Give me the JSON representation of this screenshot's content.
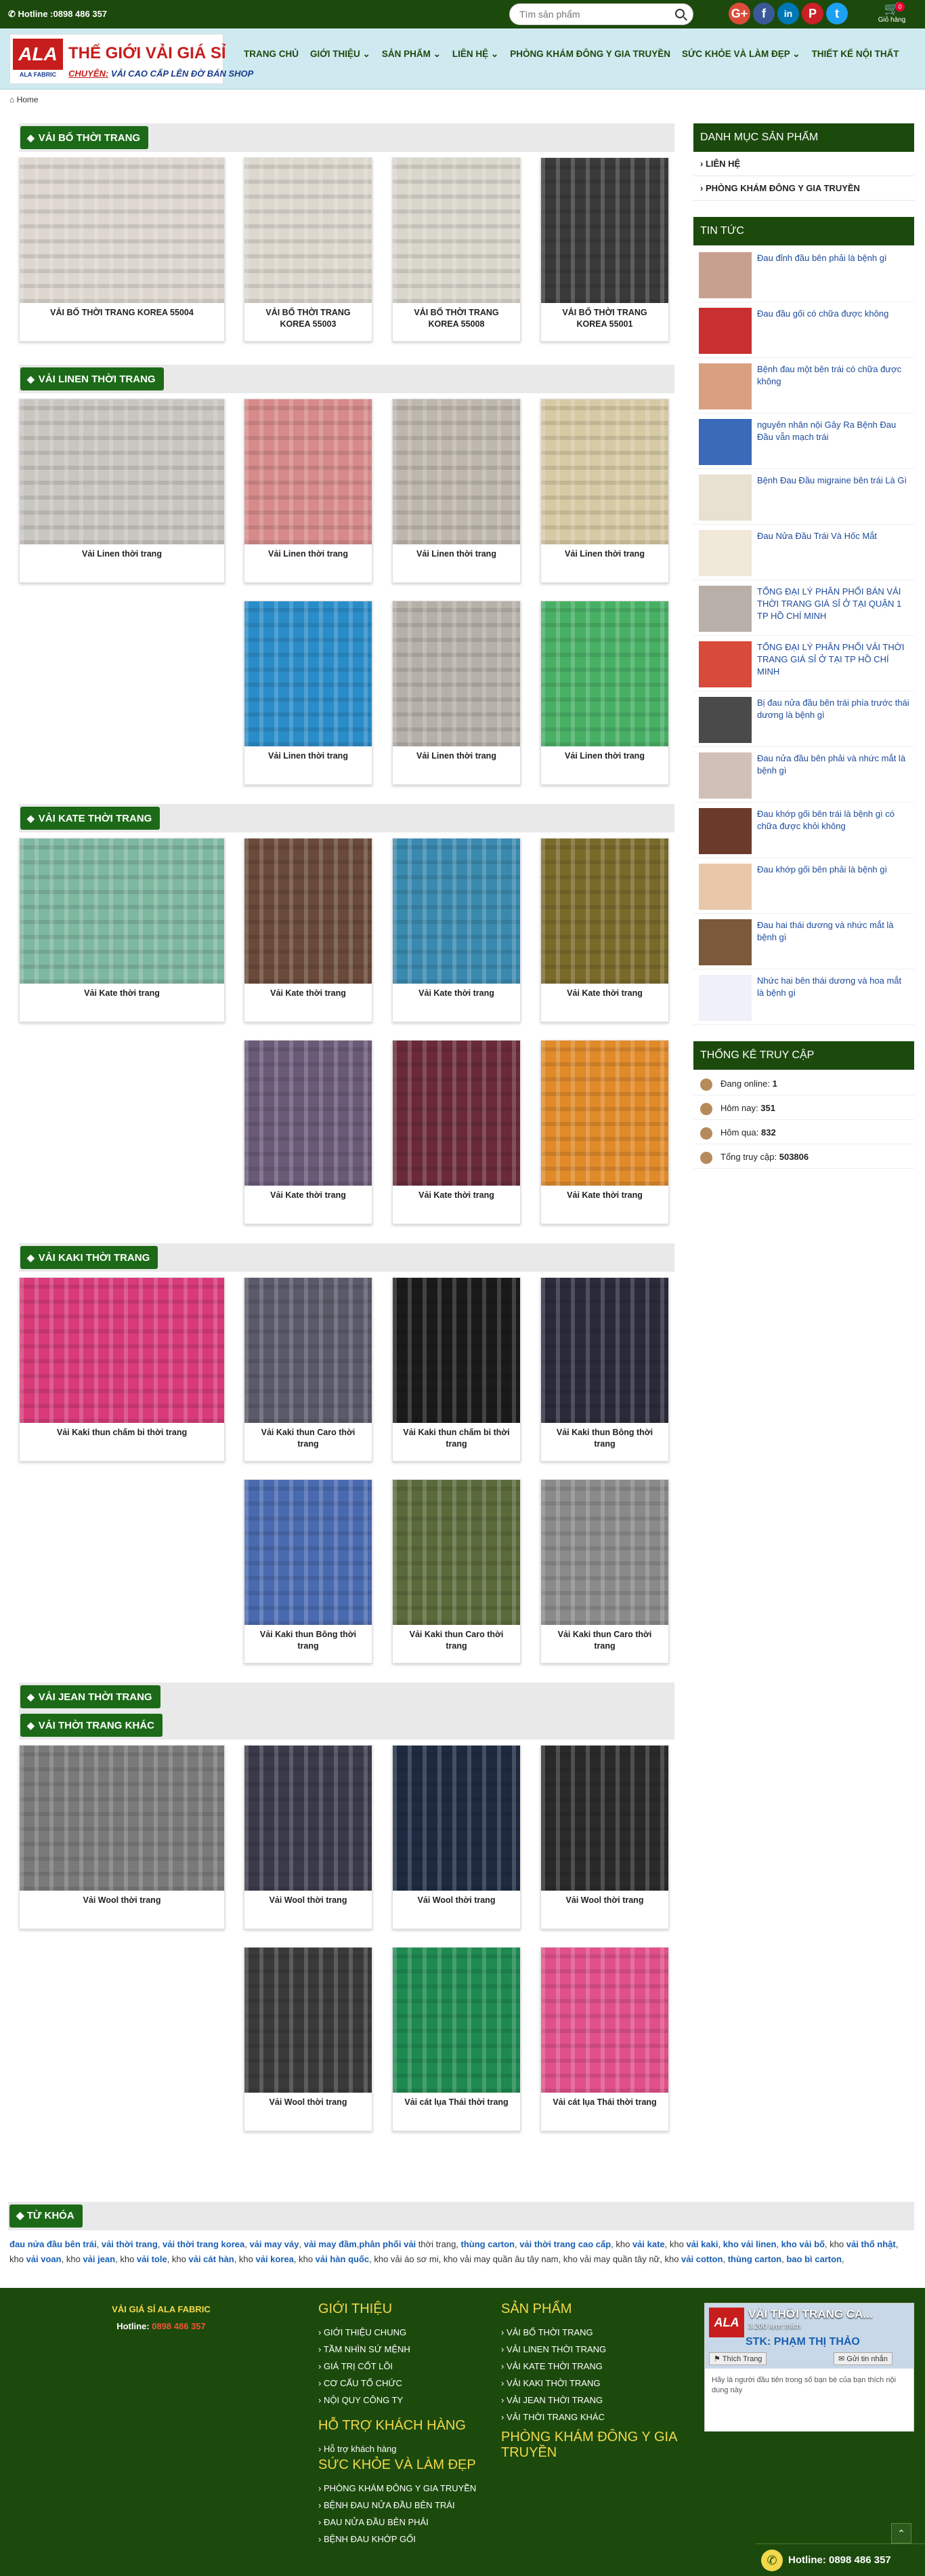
{
  "topbar": {
    "hotline": "Hotline :0898 486 357",
    "search_placeholder": "Tìm sản phẩm",
    "cart_label": "Giỏ hàng",
    "cart_count": "0",
    "social": [
      "G+",
      "f",
      "in",
      "P",
      "t"
    ]
  },
  "logo": {
    "mark": "ALA",
    "brand": "ALA FABRIC",
    "title": "THẾ GIỚI VẢI GIÁ SỈ",
    "tagline_prefix": "CHUYÊN:",
    "tagline": "VẢI CAO CẤP LÊN ĐỜ BÁN SHOP"
  },
  "nav": [
    "TRANG CHỦ",
    "GIỚI THIỆU ⌄",
    "SẢN PHẨM ⌄",
    "LIÊN HỆ ⌄",
    "PHÒNG KHÁM ĐÔNG Y GIA TRUYỀN",
    "SỨC KHỎE VÀ LÀM ĐẸP ⌄",
    "THIẾT KẾ NỘI THẤT"
  ],
  "breadcrumb": "Home",
  "sections": [
    {
      "title": "VẢI BỐ THỜI TRANG",
      "items": [
        {
          "name": "VẢI BỐ THỜI TRANG KOREA 55004",
          "color": "#ddd7cf"
        },
        {
          "name": "VẢI BỐ THỜI TRANG KOREA 55003",
          "color": "#dcd8ce"
        },
        {
          "name": "VẢI BỐ THỜI TRANG KOREA 55008",
          "color": "#d9d6cc"
        },
        {
          "name": "VẢI BỐ THỜI TRANG KOREA 55001",
          "color": "#3a3a3a"
        }
      ]
    },
    {
      "title": "VẢI LINEN THỜI TRANG",
      "items": [
        {
          "name": "Vải Linen thời trang",
          "color": "#c8c6c0"
        },
        {
          "name": "Vải Linen thời trang",
          "color": "#d78a8a"
        },
        {
          "name": "Vải Linen thời trang",
          "color": "#bdb7ad"
        },
        {
          "name": "Vải Linen thời trang",
          "color": "#d6c9a4"
        },
        {
          "name": "Vải Linen thời trang",
          "color": "#2a8cc8"
        },
        {
          "name": "Vải Linen thời trang",
          "color": "#b5b1a8"
        },
        {
          "name": "Vải Linen thời trang",
          "color": "#48b065"
        }
      ]
    },
    {
      "title": "VẢI KATE THỜI TRANG",
      "items": [
        {
          "name": "Vải Kate thời trang",
          "color": "#7fb8a0"
        },
        {
          "name": "Vải Kate thời trang",
          "color": "#6a4a3a"
        },
        {
          "name": "Vải Kate thời trang",
          "color": "#3a8ab0"
        },
        {
          "name": "Vải Kate thời trang",
          "color": "#7a6a2a"
        },
        {
          "name": "Vải Kate thời trang",
          "color": "#6a5a78"
        },
        {
          "name": "Vải Kate thời trang",
          "color": "#6a2a3a"
        },
        {
          "name": "Vải Kate thời trang",
          "color": "#e08a2a"
        }
      ]
    },
    {
      "title": "VẢI KAKI THỜI TRANG",
      "items": [
        {
          "name": "Vải Kaki thun chấm bi thời trang",
          "color": "#d83a7a"
        },
        {
          "name": "Vải Kaki thun Caro thời trang",
          "color": "#5a5a6a"
        },
        {
          "name": "Vải Kaki thun chấm bi thời trang",
          "color": "#1a1a1a"
        },
        {
          "name": "Vải Kaki thun Bông thời trang",
          "color": "#2a2a3a"
        },
        {
          "name": "Vải Kaki thun Bông thời trang",
          "color": "#4a6ab0"
        },
        {
          "name": "Vải Kaki thun Caro thời trang",
          "color": "#5a6a3a"
        },
        {
          "name": "Vải Kaki thun Caro thời trang",
          "color": "#8a8a8a"
        }
      ]
    },
    {
      "title": "VẢI JEAN THỜI TRANG",
      "items": []
    },
    {
      "title": "VẢI THỜI TRANG KHÁC",
      "items": [
        {
          "name": "Vải Wool thời trang",
          "color": "#7a7a7a"
        },
        {
          "name": "Vải Wool thời trang",
          "color": "#3a3a4a"
        },
        {
          "name": "Vải Wool thời trang",
          "color": "#1e2a40"
        },
        {
          "name": "Vải Wool thời trang",
          "color": "#2a2a2a"
        },
        {
          "name": "Vải Wool thời trang",
          "color": "#3a3a3a"
        },
        {
          "name": "Vải cát lụa Thái thời trang",
          "color": "#1e8a50"
        },
        {
          "name": "Vải cát lụa Thái thời trang",
          "color": "#e0508a"
        }
      ]
    }
  ],
  "sidebar": {
    "cat_title": "DANH MỤC SẢN PHẨM",
    "categories": [
      "› LIÊN HỆ",
      "› PHÒNG KHÁM ĐÔNG Y GIA TRUYỀN"
    ],
    "news_title": "TIN TỨC",
    "news": [
      {
        "t": "Đau đỉnh đầu bên phải là bệnh gì",
        "c": "#c8a090"
      },
      {
        "t": "Đau đầu gối có chữa được không",
        "c": "#c83030"
      },
      {
        "t": "Bệnh đau một bên trái có chữa được không",
        "c": "#d8a080"
      },
      {
        "t": "nguyên nhân nội Gây Ra Bệnh Đau Đầu vẫn mạch trái",
        "c": "#3a6ab8"
      },
      {
        "t": "Bệnh Đau Đầu migraine bên trái Là Gì",
        "c": "#e8e0d0"
      },
      {
        "t": "Đau Nửa Đầu Trái Và Hốc Mắt",
        "c": "#f0e8d8"
      },
      {
        "t": "TỔNG ĐẠI LÝ PHÂN PHỐI BÁN VẢI THỜI TRANG GIÁ SỈ Ở TẠI QUẬN 1 TP HỒ CHÍ MINH",
        "c": "#b8b0a8"
      },
      {
        "t": "TỔNG ĐẠI LÝ PHÂN PHỐI VẢI THỜI TRANG GIÁ SỈ Ở TẠI TP HỒ CHÍ MINH",
        "c": "#d84a3a"
      },
      {
        "t": "Bị đau nửa đầu bên trái phía trước thái dương là bệnh gì",
        "c": "#4a4a4a"
      },
      {
        "t": "Đau nửa đầu bên phải và nhức mắt là bệnh gì",
        "c": "#d0c0b8"
      },
      {
        "t": "Đau khớp gối bên trái là bệnh gì có chữa được khỏi không",
        "c": "#6a3a2a"
      },
      {
        "t": "Đau khớp gối bên phải là bệnh gì",
        "c": "#e8c8a8"
      },
      {
        "t": "Đau hai thái dương và nhức mắt là bệnh gì",
        "c": "#7a5a3a"
      },
      {
        "t": "Nhức hai bên thái dương và hoa mắt là bệnh gì",
        "c": "#f0f0f8"
      }
    ],
    "stats_title": "THỐNG KÊ TRUY CẬP",
    "stats": [
      {
        "label": "Đang online:",
        "value": "1"
      },
      {
        "label": "Hôm nay:",
        "value": "351"
      },
      {
        "label": "Hôm qua:",
        "value": "832"
      },
      {
        "label": "Tổng truy cập:",
        "value": "503806"
      }
    ]
  },
  "keywords": {
    "title": "TỪ KHÓA",
    "text": [
      [
        "đau nửa đầu bên trái",
        1
      ],
      [
        ", ",
        0
      ],
      [
        "vải thời trang",
        1
      ],
      [
        ", ",
        0
      ],
      [
        "vải thời trang korea",
        1
      ],
      [
        ", ",
        0
      ],
      [
        "vải may váy",
        1
      ],
      [
        ", ",
        0
      ],
      [
        "vải may đầm",
        1
      ],
      [
        ",",
        0
      ],
      [
        "phân phối vải",
        1
      ],
      [
        " thời trang, ",
        0
      ],
      [
        "thùng carton",
        1
      ],
      [
        ", ",
        0
      ],
      [
        "vải thời trang cao cấp",
        1
      ],
      [
        ", kho ",
        0
      ],
      [
        "vải kate",
        1
      ],
      [
        ", kho ",
        0
      ],
      [
        "vải kaki",
        1
      ],
      [
        ", ",
        0
      ],
      [
        "kho vải linen",
        1
      ],
      [
        ", ",
        0
      ],
      [
        "kho vải bố",
        1
      ],
      [
        ", kho ",
        0
      ],
      [
        "vải thổ nhật",
        1
      ],
      [
        ", kho ",
        0
      ],
      [
        "vải voan",
        1
      ],
      [
        ", kho ",
        0
      ],
      [
        "vải jean",
        1
      ],
      [
        ", kho ",
        0
      ],
      [
        "vải tole",
        1
      ],
      [
        ", kho ",
        0
      ],
      [
        "vải cát hàn",
        1
      ],
      [
        ", kho ",
        0
      ],
      [
        "vải korea",
        1
      ],
      [
        ", kho ",
        0
      ],
      [
        "vải hàn quốc",
        1
      ],
      [
        ", kho vải áo sơ mi, kho vải may quần âu tây nam, kho vải may quần tây nữ, kho ",
        0
      ],
      [
        "vải cotton",
        1
      ],
      [
        ", ",
        0
      ],
      [
        "thùng carton",
        1
      ],
      [
        ", ",
        0
      ],
      [
        "bao bì carton",
        1
      ],
      [
        ",",
        0
      ]
    ]
  },
  "footer": {
    "company": "VẢI GIÁ SỈ ALA FABRIC",
    "hotline_label": "Hotline:",
    "hotline": "0898 486 357",
    "gioithieu_title": "GIỚI THIỆU",
    "gioithieu": [
      "› GIỚI THIỆU CHUNG",
      "› TẦM NHÌN SỨ MỆNH",
      "› GIÁ TRỊ CỐT LÕI",
      "› CƠ CẤU TỔ CHỨC",
      "› NỘI QUY CÔNG TY"
    ],
    "hotro_title": "HỖ TRỢ KHÁCH HÀNG",
    "hotro": [
      "› Hỗ trợ khách hàng"
    ],
    "suckhoe_title": "SỨC KHỎE VÀ LÀM ĐẸP",
    "suckhoe": [
      "› PHÒNG KHÁM ĐÔNG Y GIA TRUYỀN",
      "› BỆNH ĐAU NỬA ĐẦU BÊN TRÁI",
      "› ĐAU NỬA ĐẦU BÊN PHẢI",
      "› BỆNH ĐAU KHỚP GỐI"
    ],
    "sanpham_title": "SẢN PHẨM",
    "sanpham": [
      "› VẢI BỐ THỜI TRANG",
      "› VẢI LINEN THỜI TRANG",
      "› VẢI KATE THỜI TRANG",
      "› VẢI KAKI THỜI TRANG",
      "› VẢI JEAN THỜI TRANG",
      "› VẢI THỜI TRANG KHÁC"
    ],
    "phongkham_title": "PHÒNG KHÁM ĐÔNG Y GIA TRUYỀN",
    "fb_title": "VẢI THỜI TRANG CA...",
    "fb_likes": "3.200 lượt thích",
    "fb_stk": "STK: PHẠM THỊ THẢO",
    "fb_like": "Thích Trang",
    "fb_share": "Gửi tin nhắn",
    "fb_note": "Hãy là người đầu tiên trong số bạn bè của bạn thích nội dung này",
    "bottom_hotline": "Hotline: 0898 486 357"
  }
}
